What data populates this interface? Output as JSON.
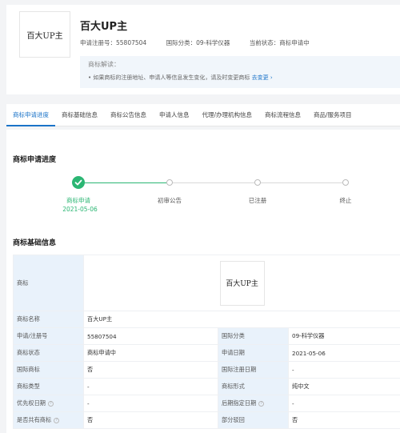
{
  "header": {
    "logo_text": "百大UP主",
    "title": "百大UP主",
    "reg_no": "申请注册号：55807504",
    "intl_class": "国际分类：09-科学仪器",
    "status": "当前状态：商标申请中",
    "tip_title": "商标解读：",
    "tip_text": "• 如果商标的注册地址、申请人等信息发生变化，请及时变更商标",
    "tip_link": "去变更 ›"
  },
  "tabs": [
    "商标申请进度",
    "商标基础信息",
    "商标公告信息",
    "申请人信息",
    "代理/办理机构信息",
    "商标流程信息",
    "商品/服务项目"
  ],
  "progress": {
    "title": "商标申请进度",
    "steps": [
      {
        "label": "商标申请",
        "date": "2021-05-06",
        "done": true
      },
      {
        "label": "初审公告",
        "done": false
      },
      {
        "label": "已注册",
        "done": false
      },
      {
        "label": "终止",
        "done": false
      }
    ]
  },
  "basic": {
    "title": "商标基础信息",
    "logo_label": "商标",
    "logo_text": "百大UP主",
    "name_label": "商标名称",
    "name_value": "百大UP主",
    "rows": [
      {
        "k1": "申请/注册号",
        "v1": "55807504",
        "k2": "国际分类",
        "v2": "09-科学仪器"
      },
      {
        "k1": "商标状态",
        "v1": "商标申请中",
        "k2": "申请日期",
        "v2": "2021-05-06"
      },
      {
        "k1": "国际商标",
        "v1": "否",
        "k2": "国际注册日期",
        "v2": "-"
      },
      {
        "k1": "商标类型",
        "v1": "-",
        "k2": "商标形式",
        "v2": "纯中文"
      },
      {
        "k1": "优先权日期",
        "v1": "-",
        "k2": "后期指定日期",
        "v2": "-"
      },
      {
        "k1": "是否共有商标",
        "v1": "否",
        "k2": "部分驳回",
        "v2": "否"
      }
    ]
  },
  "colors": {
    "accent": "#1a73c8",
    "success": "#2bb673",
    "key_bg": "#e9f2fb"
  }
}
